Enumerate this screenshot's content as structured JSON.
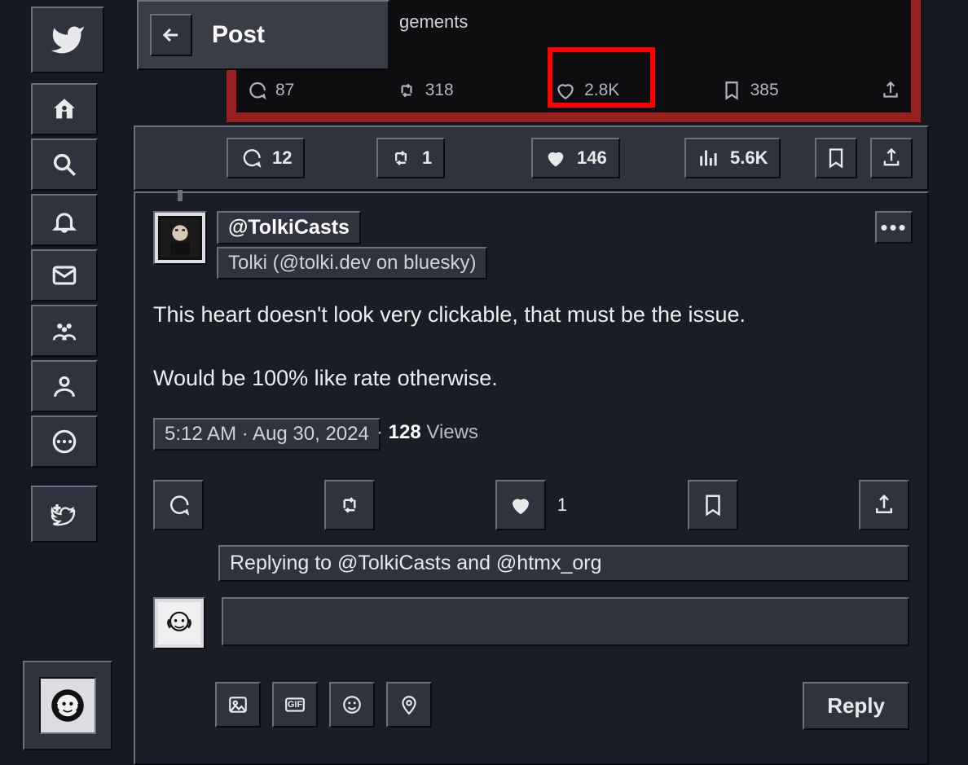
{
  "header": {
    "title": "Post"
  },
  "top_card": {
    "partial_text": "gements",
    "stats": {
      "replies": "87",
      "retweets": "318",
      "likes": "2.8K",
      "bookmarks": "385"
    }
  },
  "row1": {
    "replies": "12",
    "retweets": "1",
    "likes": "146",
    "views": "5.6K"
  },
  "post": {
    "handle": "@TolkiCasts",
    "display_name": "Tolki (@tolki.dev on bluesky)",
    "body": "This heart doesn't look very clickable, that must be the issue.\n\nWould be 100% like rate otherwise.",
    "timestamp": "5:12 AM · Aug 30, 2024",
    "views_count": "128",
    "views_label": "Views",
    "actions": {
      "likes": "1"
    }
  },
  "reply": {
    "replying_to": "Replying to @TolkiCasts and @htmx_org",
    "button": "Reply"
  },
  "attach_gif_label": "GIF"
}
